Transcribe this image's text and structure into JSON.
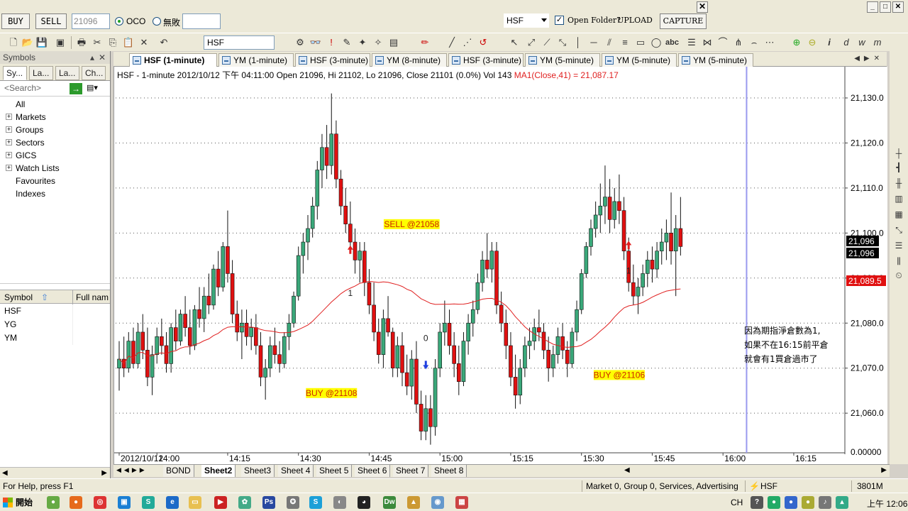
{
  "order_bar": {
    "buy_label": "BUY",
    "sell_label": "SELL",
    "qty_value": "21096",
    "oco_label": "OCO",
    "none_label": "無敗",
    "symbol_value": "HSF",
    "open_folder_label": "Open Folder?",
    "upload_label": "UPLOAD",
    "capture_label": "CAPTURE",
    "close_glyph": "✕"
  },
  "window_buttons": {
    "min": "_",
    "max": "□",
    "close": "✕"
  },
  "toolbar": {
    "symbol_value": "HSF"
  },
  "symbols_panel": {
    "title": "Symbols",
    "pin_glyph": "▴",
    "close_glyph": "✕",
    "tabs": [
      "Sy...",
      "La...",
      "La...",
      "Ch..."
    ],
    "search_placeholder": "<Search>",
    "tree": [
      {
        "label": "All",
        "expandable": false
      },
      {
        "label": "Markets",
        "expandable": true
      },
      {
        "label": "Groups",
        "expandable": true
      },
      {
        "label": "Sectors",
        "expandable": true
      },
      {
        "label": "GICS",
        "expandable": true
      },
      {
        "label": "Watch Lists",
        "expandable": true
      },
      {
        "label": "Favourites",
        "expandable": false
      },
      {
        "label": "Indexes",
        "expandable": false
      }
    ],
    "table_header": {
      "col1": "Symbol",
      "col2": "Full nam"
    },
    "rows": [
      "HSF",
      "YG",
      "YM"
    ]
  },
  "chart_tabs": [
    {
      "label": "HSF (1-minute)",
      "active": true
    },
    {
      "label": "YM (1-minute)",
      "active": false
    },
    {
      "label": "HSF (3-minute)",
      "active": false
    },
    {
      "label": "YM (8-minute)",
      "active": false
    },
    {
      "label": "HSF (3-minute)",
      "active": false
    },
    {
      "label": "YM (5-minute)",
      "active": false
    },
    {
      "label": "YM (5-minute)",
      "active": false
    },
    {
      "label": "YM (5-minute)",
      "active": false
    }
  ],
  "chart_info": {
    "main": "HSF - 1-minute 2012/10/12 下午 04:11:00 Open 21096, Hi 21102, Lo 21096, Close 21101 (0.0%) Vol 143",
    "ma": "MA1(Close,41) = 21,087.17"
  },
  "chart_data": {
    "type": "candlestick",
    "symbol": "HSF",
    "interval": "1-minute",
    "y_ticks": [
      21060,
      21070,
      21080,
      21090,
      21100,
      21110,
      21120,
      21130
    ],
    "y_tick_labels": [
      "21,060.0",
      "21,070.0",
      "21,080.0",
      "21,090.0",
      "21,100.0",
      "21,110.0",
      "21,120.0",
      "21,130.0"
    ],
    "y_bottom_label": "0.00000",
    "ylim": [
      21050,
      21133
    ],
    "x_labels": [
      {
        "label": "2012/10/12",
        "index": 0
      },
      {
        "label": "14:00",
        "index": 8
      },
      {
        "label": "14:15",
        "index": 23
      },
      {
        "label": "14:30",
        "index": 38
      },
      {
        "label": "14:45",
        "index": 53
      },
      {
        "label": "15:00",
        "index": 68
      },
      {
        "label": "15:15",
        "index": 83
      },
      {
        "label": "15:30",
        "index": 98
      },
      {
        "label": "15:45",
        "index": 113
      },
      {
        "label": "16:00",
        "index": 128
      },
      {
        "label": "16:15",
        "index": 143
      }
    ],
    "last_price_labels": [
      "21,096",
      "21,096"
    ],
    "ma_label": "21,089.5",
    "cursor_index": 133,
    "candles": [
      [
        21070,
        21076,
        21065,
        21072
      ],
      [
        21072,
        21077,
        21068,
        21070
      ],
      [
        21070,
        21078,
        21069,
        21076
      ],
      [
        21076,
        21079,
        21070,
        21071
      ],
      [
        21071,
        21080,
        21070,
        21078
      ],
      [
        21078,
        21082,
        21072,
        21074
      ],
      [
        21074,
        21079,
        21066,
        21068
      ],
      [
        21068,
        21075,
        21064,
        21073
      ],
      [
        21073,
        21079,
        21071,
        21077
      ],
      [
        21077,
        21081,
        21073,
        21075
      ],
      [
        21075,
        21078,
        21069,
        21071
      ],
      [
        21071,
        21080,
        21069,
        21079
      ],
      [
        21079,
        21083,
        21074,
        21076
      ],
      [
        21076,
        21083,
        21075,
        21082
      ],
      [
        21082,
        21086,
        21077,
        21079
      ],
      [
        21079,
        21083,
        21073,
        21075
      ],
      [
        21075,
        21084,
        21074,
        21083
      ],
      [
        21083,
        21088,
        21079,
        21081
      ],
      [
        21081,
        21088,
        21078,
        21086
      ],
      [
        21086,
        21091,
        21082,
        21084
      ],
      [
        21084,
        21093,
        21083,
        21092
      ],
      [
        21092,
        21096,
        21086,
        21088
      ],
      [
        21088,
        21098,
        21087,
        21097
      ],
      [
        21097,
        21105,
        21089,
        21091
      ],
      [
        21091,
        21094,
        21080,
        21082
      ],
      [
        21082,
        21085,
        21076,
        21078
      ],
      [
        21078,
        21083,
        21072,
        21080
      ],
      [
        21080,
        21083,
        21075,
        21077
      ],
      [
        21077,
        21081,
        21074,
        21079
      ],
      [
        21079,
        21082,
        21073,
        21075
      ],
      [
        21075,
        21078,
        21066,
        21068
      ],
      [
        21068,
        21072,
        21063,
        21070
      ],
      [
        21070,
        21077,
        21068,
        21075
      ],
      [
        21075,
        21079,
        21071,
        21073
      ],
      [
        21073,
        21076,
        21069,
        21071
      ],
      [
        21071,
        21078,
        21070,
        21077
      ],
      [
        21077,
        21082,
        21074,
        21080
      ],
      [
        21080,
        21087,
        21079,
        21086
      ],
      [
        21086,
        21097,
        21085,
        21095
      ],
      [
        21095,
        21100,
        21091,
        21098
      ],
      [
        21098,
        21104,
        21094,
        21101
      ],
      [
        21101,
        21108,
        21099,
        21106
      ],
      [
        21106,
        21116,
        21103,
        21114
      ],
      [
        21114,
        21122,
        21110,
        21119
      ],
      [
        21119,
        21124,
        21112,
        21115
      ],
      [
        21115,
        21131,
        21113,
        21122
      ],
      [
        21122,
        21125,
        21110,
        21112
      ],
      [
        21112,
        21114,
        21104,
        21106
      ],
      [
        21106,
        21110,
        21100,
        21102
      ],
      [
        21102,
        21107,
        21096,
        21098
      ],
      [
        21098,
        21101,
        21091,
        21094
      ],
      [
        21094,
        21098,
        21089,
        21096
      ],
      [
        21096,
        21098,
        21086,
        21089
      ],
      [
        21089,
        21092,
        21082,
        21084
      ],
      [
        21084,
        21089,
        21076,
        21078
      ],
      [
        21078,
        21081,
        21071,
        21073
      ],
      [
        21073,
        21083,
        21070,
        21081
      ],
      [
        21081,
        21086,
        21077,
        21078
      ],
      [
        21078,
        21079,
        21068,
        21070
      ],
      [
        21070,
        21077,
        21068,
        21075
      ],
      [
        21075,
        21078,
        21066,
        21069
      ],
      [
        21069,
        21073,
        21064,
        21066
      ],
      [
        21066,
        21074,
        21063,
        21072
      ],
      [
        21072,
        21076,
        21060,
        21062
      ],
      [
        21062,
        21065,
        21054,
        21056
      ],
      [
        21056,
        21064,
        21054,
        21061
      ],
      [
        21061,
        21064,
        21053,
        21057
      ],
      [
        21057,
        21072,
        21055,
        21070
      ],
      [
        21070,
        21080,
        21068,
        21078
      ],
      [
        21078,
        21085,
        21075,
        21080
      ],
      [
        21080,
        21083,
        21073,
        21075
      ],
      [
        21075,
        21078,
        21068,
        21071
      ],
      [
        21071,
        21075,
        21064,
        21067
      ],
      [
        21067,
        21078,
        21066,
        21076
      ],
      [
        21076,
        21082,
        21073,
        21080
      ],
      [
        21080,
        21085,
        21077,
        21083
      ],
      [
        21083,
        21091,
        21082,
        21089
      ],
      [
        21089,
        21096,
        21087,
        21094
      ],
      [
        21094,
        21100,
        21090,
        21092
      ],
      [
        21092,
        21098,
        21089,
        21096
      ],
      [
        21096,
        21098,
        21082,
        21084
      ],
      [
        21084,
        21087,
        21078,
        21080
      ],
      [
        21080,
        21083,
        21072,
        21075
      ],
      [
        21075,
        21078,
        21066,
        21068
      ],
      [
        21068,
        21073,
        21061,
        21064
      ],
      [
        21064,
        21072,
        21062,
        21070
      ],
      [
        21070,
        21077,
        21068,
        21075
      ],
      [
        21075,
        21079,
        21072,
        21076
      ],
      [
        21076,
        21081,
        21074,
        21079
      ],
      [
        21079,
        21083,
        21076,
        21078
      ],
      [
        21078,
        21080,
        21072,
        21074
      ],
      [
        21074,
        21077,
        21067,
        21070
      ],
      [
        21070,
        21075,
        21068,
        21073
      ],
      [
        21073,
        21079,
        21071,
        21077
      ],
      [
        21077,
        21080,
        21072,
        21074
      ],
      [
        21074,
        21076,
        21068,
        21071
      ],
      [
        21071,
        21079,
        21070,
        21078
      ],
      [
        21078,
        21085,
        21076,
        21083
      ],
      [
        21083,
        21092,
        21082,
        21091
      ],
      [
        21091,
        21098,
        21090,
        21097
      ],
      [
        21097,
        21103,
        21095,
        21101
      ],
      [
        21101,
        21107,
        21099,
        21104
      ],
      [
        21104,
        21111,
        21100,
        21106
      ],
      [
        21106,
        21115,
        21102,
        21108
      ],
      [
        21108,
        21112,
        21100,
        21103
      ],
      [
        21103,
        21110,
        21101,
        21107
      ],
      [
        21107,
        21113,
        21102,
        21105
      ],
      [
        21105,
        21108,
        21094,
        21096
      ],
      [
        21096,
        21099,
        21087,
        21089
      ],
      [
        21089,
        21093,
        21084,
        21086
      ],
      [
        21086,
        21090,
        21082,
        21088
      ],
      [
        21088,
        21093,
        21086,
        21091
      ],
      [
        21091,
        21096,
        21088,
        21094
      ],
      [
        21094,
        21097,
        21089,
        21092
      ],
      [
        21092,
        21098,
        21090,
        21096
      ],
      [
        21096,
        21101,
        21093,
        21098
      ],
      [
        21098,
        21103,
        21094,
        21100
      ],
      [
        21100,
        21109,
        21093,
        21096
      ],
      [
        21096,
        21104,
        21086,
        21101
      ],
      [
        21101,
        21108,
        21095,
        21097
      ]
    ]
  },
  "annotations": [
    {
      "text": "SELL @21058",
      "index": 62,
      "price": 21101.5,
      "color": "#ffff00",
      "text_color": "#cc2200"
    },
    {
      "text": "BUY @21108",
      "index": 45,
      "price": 21064,
      "color": "#ffff00",
      "text_color": "#cc2200"
    },
    {
      "text": "BUY @21106",
      "index": 106,
      "price": 21068,
      "color": "#ffff00",
      "text_color": "#cc2200"
    },
    {
      "text": "1",
      "index": 49,
      "price": 21086
    },
    {
      "text": "0",
      "index": 65,
      "price": 21076
    },
    {
      "text": "1",
      "index": 108,
      "price": 21091
    }
  ],
  "arrows": [
    {
      "direction": "up",
      "index": 49,
      "price": 21096,
      "color": "#e02020"
    },
    {
      "direction": "down",
      "index": 65,
      "price": 21071,
      "color": "#2040e0"
    },
    {
      "direction": "up",
      "index": 108,
      "price": 21097,
      "color": "#e02020"
    }
  ],
  "note": [
    "因為期指淨倉數為1,",
    "如果不在16:15前平倉",
    "就會有1買倉過市了"
  ],
  "sheets": [
    {
      "label": "BOND",
      "active": false
    },
    {
      "label": "Sheet2",
      "active": true
    },
    {
      "label": "Sheet3",
      "active": false
    },
    {
      "label": "Sheet 4",
      "active": false
    },
    {
      "label": "Sheet 5",
      "active": false
    },
    {
      "label": "Sheet 6",
      "active": false
    },
    {
      "label": "Sheet 7",
      "active": false
    },
    {
      "label": "Sheet 8",
      "active": false
    }
  ],
  "status": {
    "help": "For Help, press F1",
    "market": "Market 0, Group 0, Services, Advertising",
    "symbol": "HSF",
    "memory": "3801M"
  },
  "taskbar": {
    "start_label": "開始",
    "lang": "CH",
    "clock": "上午 12:06"
  },
  "colors": {
    "up_candle": "#3aa87a",
    "down_candle": "#e01010",
    "ma_line": "#e02020",
    "cursor_line": "#9999ee"
  }
}
